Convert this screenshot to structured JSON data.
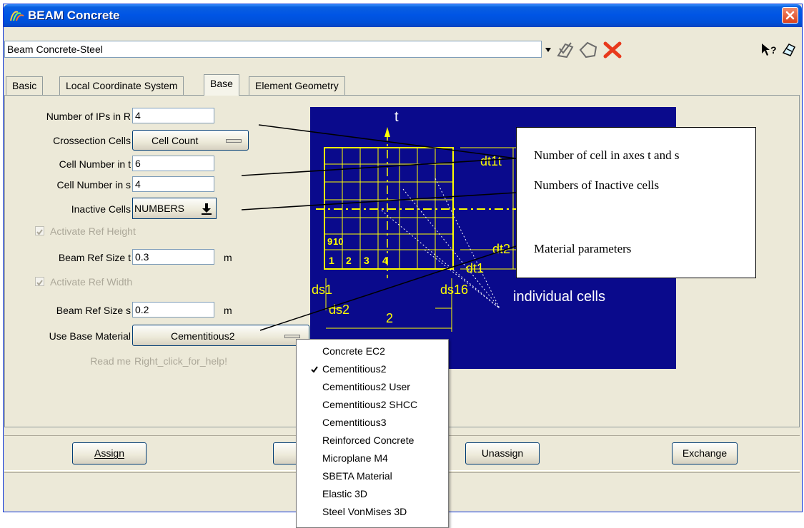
{
  "window": {
    "title": "BEAM Concrete"
  },
  "header": {
    "combo_value": "Beam Concrete-Steel"
  },
  "tabs": [
    {
      "label": "Basic"
    },
    {
      "label": "Local Coordinate System"
    },
    {
      "label": "Base"
    },
    {
      "label": "Element Geometry"
    }
  ],
  "form": {
    "ips_label": "Number of IPs in R",
    "ips_value": "4",
    "crossection_label": "Crossection Cells",
    "crossection_value": "Cell Count",
    "cell_t_label": "Cell Number in t",
    "cell_t_value": "6",
    "cell_s_label": "Cell Number in s",
    "cell_s_value": "4",
    "inactive_label": "Inactive Cells",
    "inactive_value": "NUMBERS",
    "activate_height_label": "Activate Ref Height",
    "beam_ref_t_label": "Beam Ref Size t",
    "beam_ref_t_value": "0.3",
    "beam_ref_t_unit": "m",
    "activate_width_label": "Activate Ref Width",
    "beam_ref_s_label": "Beam Ref Size s",
    "beam_ref_s_value": "0.2",
    "beam_ref_s_unit": "m",
    "base_material_label": "Use Base Material",
    "base_material_value": "Cementitious2",
    "readme_label": "Read me",
    "readme_value": "Right_click_for_help!"
  },
  "diagram": {
    "axis_t": "t",
    "label_dt1t": "dt1t",
    "label_dt2": "dt2",
    "label_dt1": "dt1",
    "label_ds1": "ds1",
    "label_ds16": "ds16",
    "label_ds2": "ds2",
    "label_2": "2",
    "individual_cells": "individual cells",
    "cells_row_top": [
      "9",
      "10"
    ],
    "cells_row_bottom": [
      "1",
      "2",
      "3",
      "4"
    ]
  },
  "callout": {
    "line1": "Number of cell in axes t and s",
    "line2": "Numbers of Inactive cells",
    "line3": "Material parameters"
  },
  "buttons": {
    "assign": "Assign",
    "unassign": "Unassign",
    "exchange": "Exchange"
  },
  "menu": {
    "items": [
      "Concrete EC2",
      "Cementitious2",
      "Cementitious2 User",
      "Cementitious2 SHCC",
      "Cementitious3",
      "Reinforced Concrete",
      "Microplane M4",
      "SBETA Material",
      "Elastic 3D",
      "Steel VonMises 3D"
    ],
    "checked": "Cementitious2"
  },
  "colors": {
    "title_bar": "#0055e5",
    "diagram_bg": "#0a0a8c",
    "diagram_lines": "#ffff00",
    "close_button": "#d9411c"
  }
}
